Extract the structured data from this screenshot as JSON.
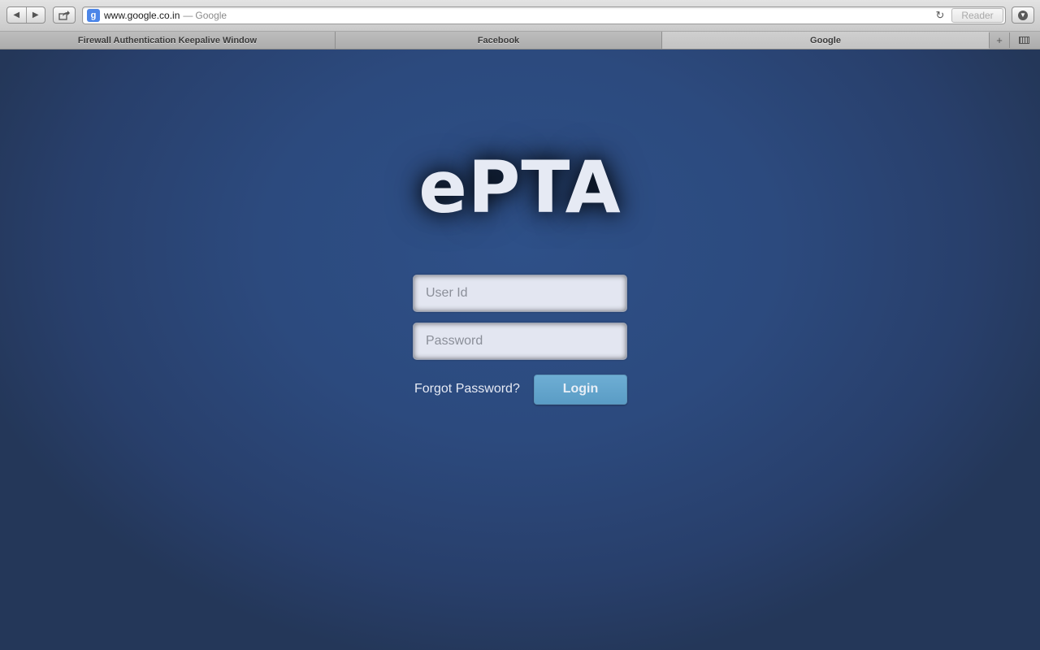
{
  "browser": {
    "url": "www.google.co.in",
    "url_separator": "—",
    "page_title": "Google",
    "reader_label": "Reader",
    "tabs": [
      {
        "label": "Firewall Authentication Keepalive Window",
        "active": false
      },
      {
        "label": "Facebook",
        "active": false
      },
      {
        "label": "Google",
        "active": true
      }
    ]
  },
  "login": {
    "logo": "ePTA",
    "userid_placeholder": "User Id",
    "password_placeholder": "Password",
    "forgot_label": "Forgot Password?",
    "login_label": "Login"
  },
  "colors": {
    "background": "#2c4a7e",
    "login_button": "#62a3cb",
    "field_background": "#e3e6f1"
  }
}
